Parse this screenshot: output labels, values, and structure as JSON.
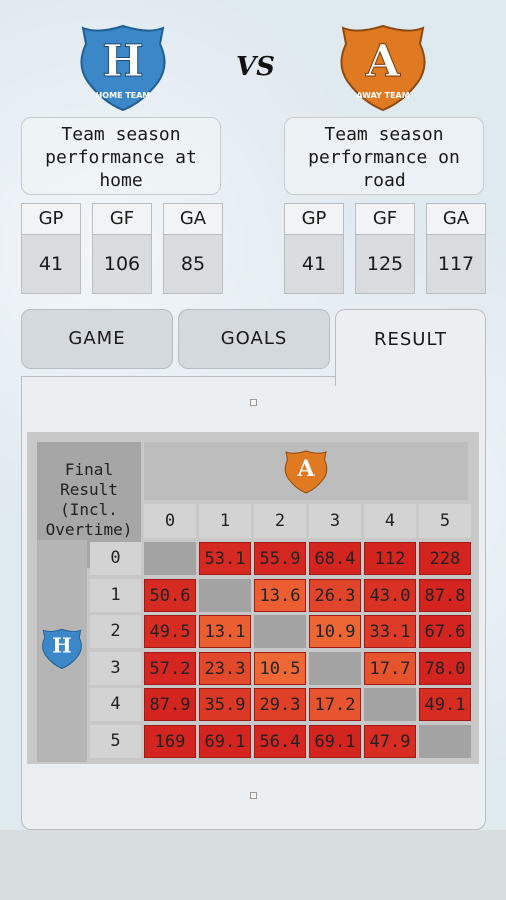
{
  "header": {
    "home_logo": {
      "letter": "H",
      "label": "HOME TEAM",
      "color": "#3a86c6"
    },
    "vs_label": "VS",
    "away_logo": {
      "letter": "A",
      "label": "AWAY TEAM",
      "color": "#e07a22"
    }
  },
  "home": {
    "title": "Team season performance at home",
    "stats": [
      {
        "label": "GP",
        "value": "41"
      },
      {
        "label": "GF",
        "value": "106"
      },
      {
        "label": "GA",
        "value": "85"
      }
    ]
  },
  "away": {
    "title": "Team season performance on road",
    "stats": [
      {
        "label": "GP",
        "value": "41"
      },
      {
        "label": "GF",
        "value": "125"
      },
      {
        "label": "GA",
        "value": "117"
      }
    ]
  },
  "tabs": [
    {
      "label": "GAME",
      "active": false
    },
    {
      "label": "GOALS",
      "active": false
    },
    {
      "label": "RESULT",
      "active": true
    }
  ],
  "result_table": {
    "corner_label": "Final Result (Incl. Overtime)",
    "away_scores": [
      "0",
      "1",
      "2",
      "3",
      "4",
      "5"
    ],
    "home_scores": [
      "0",
      "1",
      "2",
      "3",
      "4",
      "5"
    ],
    "odds": [
      [
        "",
        "53.1",
        "55.9",
        "68.4",
        "112",
        "228"
      ],
      [
        "50.6",
        "",
        "13.6",
        "26.3",
        "43.0",
        "87.8"
      ],
      [
        "49.5",
        "13.1",
        "",
        "10.9",
        "33.1",
        "67.6"
      ],
      [
        "57.2",
        "23.3",
        "10.5",
        "",
        "17.7",
        "78.0"
      ],
      [
        "87.9",
        "35.9",
        "29.3",
        "17.2",
        "",
        "49.1"
      ],
      [
        "169",
        "69.1",
        "56.4",
        "69.1",
        "47.9",
        ""
      ]
    ],
    "colors": {
      "low": "#ee6a35",
      "high": "#d42420",
      "empty": "#a3a3a3"
    }
  }
}
